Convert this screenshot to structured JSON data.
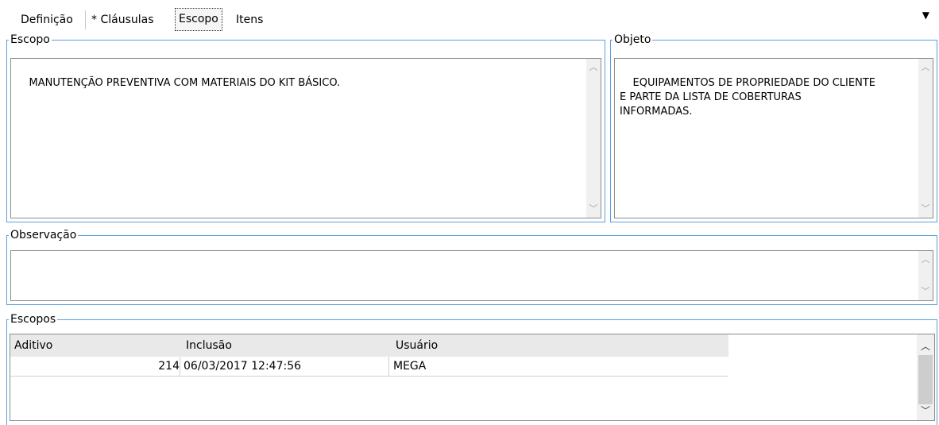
{
  "tabs": [
    {
      "label": "Definição"
    },
    {
      "label": "* Cláusulas"
    },
    {
      "label": "Escopo"
    },
    {
      "label": "Itens"
    }
  ],
  "escopo": {
    "title": "Escopo",
    "text": "MANUTENÇÃO PREVENTIVA COM MATERIAIS DO KIT BÁSICO."
  },
  "objeto": {
    "title": "Objeto",
    "text": "EQUIPAMENTOS DE PROPRIEDADE DO CLIENTE\nE PARTE DA LISTA DE COBERTURAS\nINFORMADAS."
  },
  "observacao": {
    "title": "Observação",
    "text": ""
  },
  "escopos": {
    "title": "Escopos",
    "columns": [
      "Aditivo",
      "Inclusão",
      "Usuário"
    ],
    "rows": [
      {
        "aditivo": "214",
        "inclusao": "06/03/2017 12:47:56",
        "usuario": "MEGA"
      }
    ]
  },
  "icons": {
    "menu": "dropdown-triangle-icon",
    "scroll_up": "chevron-up-icon",
    "scroll_down": "chevron-down-icon"
  },
  "colors": {
    "group_border": "#5a9fdc",
    "header_bg": "#e9e9e9"
  }
}
